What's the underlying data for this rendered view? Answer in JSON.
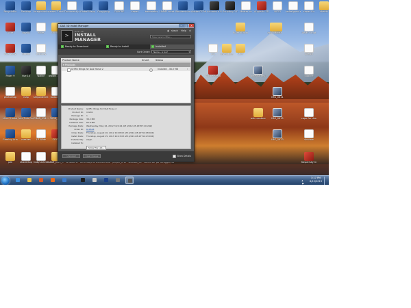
{
  "desktop_icons": [
    {
      "label": "RecycleBin",
      "kind": "app",
      "col": 0,
      "row": 0
    },
    {
      "label": "Desktop",
      "kind": "app",
      "col": 1,
      "row": 0
    },
    {
      "label": "foreground stuff",
      "kind": "folder",
      "col": 2,
      "row": 0
    },
    {
      "label": "sewer 3 stuff",
      "kind": "folder",
      "col": 3,
      "row": 0
    },
    {
      "label": "Document journal stuff",
      "kind": "doc",
      "col": 4,
      "row": 0
    },
    {
      "label": "Global Mapper",
      "kind": "app",
      "col": 5,
      "row": 0
    },
    {
      "label": "Copy/ping",
      "kind": "app",
      "col": 6,
      "row": 0
    },
    {
      "label": "CANORE",
      "kind": "doc",
      "col": 7,
      "row": 0
    },
    {
      "label": "sewer",
      "kind": "doc",
      "col": 8,
      "row": 0
    },
    {
      "label": "barometer",
      "kind": "doc",
      "col": 9,
      "row": 0
    },
    {
      "label": "LIMMY creat.txt",
      "kind": "doc",
      "col": 10,
      "row": 0
    },
    {
      "label": "Wondershare Video Conv",
      "kind": "app",
      "col": 11,
      "row": 0
    },
    {
      "label": "Adobe CS Media...",
      "kind": "app",
      "col": 12,
      "row": 0
    },
    {
      "label": "Actuator a Science d...",
      "kind": "dark",
      "col": 13,
      "row": 0
    },
    {
      "label": "Scripting 3 Fuzes Studio",
      "kind": "dark",
      "col": 14,
      "row": 0
    },
    {
      "label": "Master ce",
      "kind": "doc",
      "col": 15,
      "row": 0
    },
    {
      "label": "Augustin 3D Clothes",
      "kind": "red",
      "col": 16,
      "row": 0
    },
    {
      "label": "NICEI",
      "kind": "doc",
      "col": 17,
      "row": 0
    },
    {
      "label": "redesigned sleeve",
      "kind": "doc",
      "col": 18,
      "row": 0
    },
    {
      "label": "sewer fur",
      "kind": "doc",
      "col": 19,
      "row": 0
    },
    {
      "label": "sheets",
      "kind": "folder",
      "col": 20,
      "row": 0
    },
    {
      "label": "Avira",
      "kind": "red",
      "col": 0,
      "row": 1
    },
    {
      "label": "Daz3D",
      "kind": "app",
      "col": 1,
      "row": 1
    },
    {
      "label": "notes",
      "kind": "doc",
      "col": 2,
      "row": 1
    },
    {
      "label": "WinRAR",
      "kind": "folder",
      "col": 3,
      "row": 1
    },
    {
      "label": "Ruler pluging",
      "kind": "folder",
      "col": 14,
      "row": 1
    },
    {
      "label": "applications",
      "kind": "folder",
      "col": 16,
      "row": 1
    },
    {
      "label": "Maps",
      "kind": "folder",
      "col": 17,
      "row": 1
    },
    {
      "label": "ARMY script",
      "kind": "doc",
      "col": 19,
      "row": 1
    },
    {
      "label": "MAX 2012",
      "kind": "red",
      "col": 0,
      "row": 2
    },
    {
      "label": "Studio",
      "kind": "app",
      "col": 1,
      "row": 2
    },
    {
      "label": "textures",
      "kind": "doc",
      "col": 2,
      "row": 2
    },
    {
      "label": "bot",
      "kind": "doc",
      "col": 12,
      "row": 2
    },
    {
      "label": "my nature",
      "kind": "folder",
      "col": 13,
      "row": 2
    },
    {
      "label": "stuff",
      "kind": "folder",
      "col": 14,
      "row": 2
    },
    {
      "label": "Sketch",
      "kind": "doc",
      "col": 19,
      "row": 2
    },
    {
      "label": "Poser 9",
      "kind": "app",
      "col": 0,
      "row": 3
    },
    {
      "label": "Vue 10",
      "kind": "dark",
      "col": 1,
      "row": 3
    },
    {
      "label": "walkin",
      "kind": "doc",
      "col": 2,
      "row": 3
    },
    {
      "label": "oskars and stuff",
      "kind": "doc",
      "col": 3,
      "row": 3
    },
    {
      "label": "Adobe Reader X",
      "kind": "red",
      "col": 12,
      "row": 3
    },
    {
      "label": "oelegan tes.jpg",
      "kind": "img",
      "col": 15,
      "row": 3
    },
    {
      "label": "publine",
      "kind": "doc",
      "col": 19,
      "row": 3
    },
    {
      "label": "photoshop",
      "kind": "doc",
      "col": 0,
      "row": 4
    },
    {
      "label": "map",
      "kind": "folder",
      "col": 1,
      "row": 4
    },
    {
      "label": "tailpond0001",
      "kind": "folder",
      "col": 2,
      "row": 4
    },
    {
      "label": "kodown...",
      "kind": "doc",
      "col": 3,
      "row": 4
    },
    {
      "label": "IMG_0611",
      "kind": "img",
      "col": 17,
      "row": 4
    },
    {
      "label": "Ultra Fractal 5.02",
      "kind": "app",
      "col": 0,
      "row": 5
    },
    {
      "label": "Vue Turb Collectio...",
      "kind": "app",
      "col": 1,
      "row": 5
    },
    {
      "label": "CBAB_034...",
      "kind": "doc",
      "col": 2,
      "row": 5
    },
    {
      "label": "30G8_1k...",
      "kind": "app",
      "col": 3,
      "row": 5
    },
    {
      "label": "ask creature creator",
      "kind": "folder",
      "col": 15,
      "row": 5
    },
    {
      "label": "IMG_0615",
      "kind": "img",
      "col": 17,
      "row": 5
    },
    {
      "label": "cape for desert rift.pdf",
      "kind": "doc",
      "col": 19,
      "row": 5
    },
    {
      "label": "Gaming Aria 3",
      "kind": "app",
      "col": 0,
      "row": 6
    },
    {
      "label": "meshes",
      "kind": "folder",
      "col": 1,
      "row": 6
    },
    {
      "label": "LP Wide",
      "kind": "doc",
      "col": 2,
      "row": 6
    },
    {
      "label": "CIO13",
      "kind": "red",
      "col": 3,
      "row": 6
    },
    {
      "label": "IMG_0623",
      "kind": "img",
      "col": 17,
      "row": 6
    },
    {
      "label": "shadow",
      "kind": "doc",
      "col": 19,
      "row": 6
    },
    {
      "label": "pat",
      "kind": "folder",
      "col": 0,
      "row": 7
    },
    {
      "label": "shadertop",
      "kind": "doc",
      "col": 1,
      "row": 7
    },
    {
      "label": "CAD/carteste",
      "kind": "doc",
      "col": 2,
      "row": 7
    },
    {
      "label": "skaff_CGS_CUT",
      "kind": "folder",
      "col": 3,
      "row": 7
    },
    {
      "label": "smaidens",
      "kind": "folder",
      "col": 4,
      "row": 7
    },
    {
      "label": "officedaythes",
      "kind": "doc",
      "col": 5,
      "row": 7
    },
    {
      "label": "Democrania Trivia Map",
      "kind": "folder",
      "col": 6,
      "row": 7
    },
    {
      "label": "purple_end",
      "kind": "doc",
      "col": 7,
      "row": 7
    },
    {
      "label": "shadow_ex",
      "kind": "doc",
      "col": 8,
      "row": 7
    },
    {
      "label": "concertur past fitness",
      "kind": "doc",
      "col": 9,
      "row": 7
    },
    {
      "label": "struggle.txt",
      "kind": "doc",
      "col": 10,
      "row": 7
    },
    {
      "label": "Kaspersky Internet",
      "kind": "red",
      "col": 19,
      "row": 7
    }
  ],
  "taskbar": {
    "items": [
      "ie-icon",
      "explorer-icon",
      "media-icon",
      "firefox-icon",
      "outlook-icon",
      "daz-icon",
      "notepad-icon",
      "photoshop-icon",
      "vue-icon",
      "install-manager-icon"
    ],
    "clock_time": "3:17 PM",
    "clock_date": "8/15/2013"
  },
  "window": {
    "title": "DAZ 3D Install Manager",
    "logo_line1": "DAZ 3D",
    "logo_line2a": "INSTALL",
    "logo_line2b": "MANAGER",
    "link_user": "steph",
    "link_help": "Help",
    "search_placeholder": "Type here to filter...",
    "tabs": [
      {
        "label": "Ready to Download",
        "mark": "↓"
      },
      {
        "label": "Ready to Install",
        "mark": "↑"
      },
      {
        "label": "Installed",
        "mark": "✓"
      }
    ],
    "sort_label": "Sort Order:",
    "sort_value": "Name - A to Z",
    "columns": {
      "product_name": "Product Name",
      "smart": "Smart",
      "status": "Status"
    },
    "group_label": "Products",
    "product": {
      "name": "Griffin Wings for DAZ Horse 2",
      "status": "Installed - 38.0 MB"
    },
    "details": [
      {
        "key": "Product Name:",
        "value": "Griffin Wings for DAZ Horse 2"
      },
      {
        "key": "Product ID:",
        "value": "15202"
      },
      {
        "key": "Package ID:",
        "value": "1"
      },
      {
        "key": "Package Size:",
        "value": "38.2 MB"
      },
      {
        "key": "Installed Size:",
        "value": "84.8 MB"
      },
      {
        "key": "Package Date:",
        "value": "Wednesday, May 16, 2012 3:20:24 AM (2012-05-16T07:20:24Z)"
      },
      {
        "key": "Order ID:",
        "value": "618528"
      },
      {
        "key": "Order Date:",
        "value": "Thursday, August 16, 2012 10:08:02 AM (2012-08-16T14:08:02Z)"
      },
      {
        "key": "Install Date:",
        "value": "Thursday, August 15, 2013 10:23:03 AM (2013-08-15T14:23:03Z)"
      },
      {
        "key": "Installed By:",
        "value": "steph"
      },
      {
        "key": "Installed To:",
        "value": ""
      }
    ],
    "show_files": "Show File List...",
    "btn_uninstall": "Uninstall",
    "btn_clear_queue": "Clear Queue",
    "show_details": "Show Details"
  }
}
